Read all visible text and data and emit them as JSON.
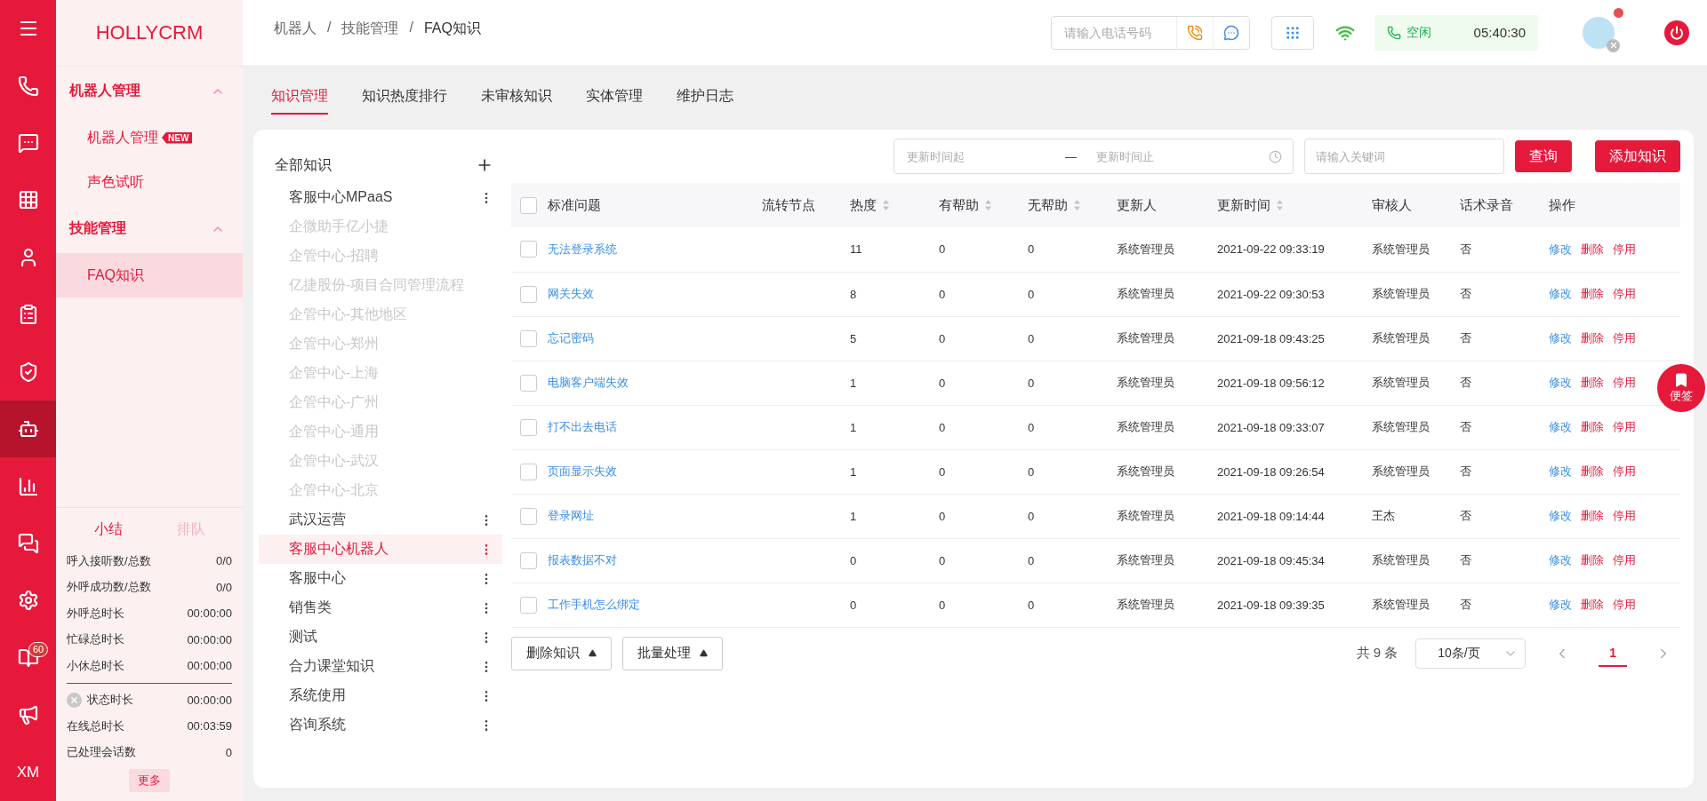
{
  "rail": {
    "items": [
      {
        "kind": "menu",
        "selected": false
      },
      {
        "kind": "phone",
        "selected": false
      },
      {
        "kind": "chat",
        "selected": false
      },
      {
        "kind": "grid",
        "selected": false
      },
      {
        "kind": "person",
        "selected": false
      },
      {
        "kind": "clipboard",
        "selected": false
      },
      {
        "kind": "shield",
        "selected": false
      },
      {
        "kind": "robot",
        "selected": true
      },
      {
        "kind": "chart",
        "selected": false
      },
      {
        "kind": "messages",
        "selected": false
      },
      {
        "kind": "gear",
        "selected": false
      },
      {
        "kind": "book",
        "selected": false,
        "badge": "60"
      },
      {
        "kind": "megaphone",
        "selected": false
      },
      {
        "kind": "text",
        "selected": false,
        "label": "XM"
      }
    ]
  },
  "sidebar": {
    "logo": "HOLLYCRM",
    "groups": [
      {
        "title": "机器人管理",
        "expanded": true,
        "items": [
          {
            "label": "机器人管理",
            "selected": false,
            "badge": "NEW"
          },
          {
            "label": "声色试听",
            "selected": false
          }
        ]
      },
      {
        "title": "技能管理",
        "expanded": true,
        "items": [
          {
            "label": "FAQ知识",
            "selected": true
          }
        ]
      }
    ],
    "stats": {
      "tabs": [
        {
          "label": "小结",
          "selected": true
        },
        {
          "label": "排队",
          "selected": false
        }
      ],
      "rows": [
        {
          "label": "呼入接听数/总数",
          "value": "0/0"
        },
        {
          "label": "外呼成功数/总数",
          "value": "0/0"
        },
        {
          "label": "外呼总时长",
          "value": "00:00:00"
        },
        {
          "label": "忙碌总时长",
          "value": "00:00:00"
        },
        {
          "label": "小休总时长",
          "value": "00:00:00"
        }
      ],
      "rows_after": [
        {
          "label": "状态时长",
          "value": "00:00:00",
          "kind": "status"
        },
        {
          "label": "在线总时长",
          "value": "00:03:59",
          "kind": "plain"
        },
        {
          "label": "已处理会话数",
          "value": "0",
          "kind": "plain"
        }
      ],
      "more": "更多"
    }
  },
  "topbar": {
    "breadcrumb": [
      "机器人",
      "技能管理",
      "FAQ知识"
    ],
    "separator": "/",
    "phone": {
      "placeholder": "请输入电话号码"
    },
    "status": {
      "label": "空闲",
      "time": "05:40:30"
    },
    "avatar": {
      "notification": true
    }
  },
  "tabs": [
    {
      "label": "知识管理",
      "selected": true
    },
    {
      "label": "知识热度排行",
      "selected": false
    },
    {
      "label": "未审核知识",
      "selected": false
    },
    {
      "label": "实体管理",
      "selected": false
    },
    {
      "label": "维护日志",
      "selected": false
    }
  ],
  "tree": {
    "title": "全部知识",
    "items": [
      {
        "label": "客服中心MPaaS",
        "disabled": false,
        "selected": false
      },
      {
        "label": "企微助手亿小捷",
        "disabled": true,
        "selected": false
      },
      {
        "label": "企管中心-招聘",
        "disabled": true,
        "selected": false
      },
      {
        "label": "亿捷股份-项目合同管理流程",
        "disabled": true,
        "selected": false
      },
      {
        "label": "企管中心-其他地区",
        "disabled": true,
        "selected": false
      },
      {
        "label": "企管中心-郑州",
        "disabled": true,
        "selected": false
      },
      {
        "label": "企管中心-上海",
        "disabled": true,
        "selected": false
      },
      {
        "label": "企管中心-广州",
        "disabled": true,
        "selected": false
      },
      {
        "label": "企管中心-通用",
        "disabled": true,
        "selected": false
      },
      {
        "label": "企管中心-武汉",
        "disabled": true,
        "selected": false
      },
      {
        "label": "企管中心-北京",
        "disabled": true,
        "selected": false
      },
      {
        "label": "武汉运营",
        "disabled": false,
        "selected": false
      },
      {
        "label": "客服中心机器人",
        "disabled": false,
        "selected": true
      },
      {
        "label": "客服中心",
        "disabled": false,
        "selected": false
      },
      {
        "label": "销售类",
        "disabled": false,
        "selected": false
      },
      {
        "label": "测试",
        "disabled": false,
        "selected": false
      },
      {
        "label": "合力课堂知识",
        "disabled": false,
        "selected": false
      },
      {
        "label": "系统使用",
        "disabled": false,
        "selected": false
      },
      {
        "label": "咨询系统",
        "disabled": false,
        "selected": false
      }
    ]
  },
  "filters": {
    "start": {
      "placeholder": "更新时间起"
    },
    "dash": "—",
    "end": {
      "placeholder": "更新时间止"
    },
    "keyword": {
      "placeholder": "请输入关键词"
    },
    "buttons": [
      "查询",
      "添加知识"
    ]
  },
  "table": {
    "columns": [
      {
        "label": "标准问题",
        "sortable": false
      },
      {
        "label": "流转节点",
        "sortable": false
      },
      {
        "label": "热度",
        "sortable": true
      },
      {
        "label": "有帮助",
        "sortable": true
      },
      {
        "label": "无帮助",
        "sortable": true
      },
      {
        "label": "更新人",
        "sortable": false
      },
      {
        "label": "更新时间",
        "sortable": true
      },
      {
        "label": "审核人",
        "sortable": false
      },
      {
        "label": "话术录音",
        "sortable": false
      },
      {
        "label": "操作",
        "sortable": false
      }
    ],
    "all_checked": false,
    "rows": [
      {
        "checked": false,
        "cells": [
          "无法登录系统",
          "",
          "11",
          "0",
          "0",
          "系统管理员",
          "2021-09-22 09:33:19",
          "系统管理员",
          "否"
        ],
        "actions": [
          {
            "label": "修改",
            "kind": "edit"
          },
          {
            "label": "删除",
            "kind": "danger"
          },
          {
            "label": "停用",
            "kind": "danger"
          }
        ]
      },
      {
        "checked": false,
        "cells": [
          "网关失效",
          "",
          "8",
          "0",
          "0",
          "系统管理员",
          "2021-09-22 09:30:53",
          "系统管理员",
          "否"
        ],
        "actions": [
          {
            "label": "修改",
            "kind": "edit"
          },
          {
            "label": "删除",
            "kind": "danger"
          },
          {
            "label": "停用",
            "kind": "danger"
          }
        ]
      },
      {
        "checked": false,
        "cells": [
          "忘记密码",
          "",
          "5",
          "0",
          "0",
          "系统管理员",
          "2021-09-18 09:43:25",
          "系统管理员",
          "否"
        ],
        "actions": [
          {
            "label": "修改",
            "kind": "edit"
          },
          {
            "label": "删除",
            "kind": "danger"
          },
          {
            "label": "停用",
            "kind": "danger"
          }
        ]
      },
      {
        "checked": false,
        "cells": [
          "电脑客户端失效",
          "",
          "1",
          "0",
          "0",
          "系统管理员",
          "2021-09-18 09:56:12",
          "系统管理员",
          "否"
        ],
        "actions": [
          {
            "label": "修改",
            "kind": "edit"
          },
          {
            "label": "删除",
            "kind": "danger"
          },
          {
            "label": "停用",
            "kind": "danger"
          }
        ]
      },
      {
        "checked": false,
        "cells": [
          "打不出去电话",
          "",
          "1",
          "0",
          "0",
          "系统管理员",
          "2021-09-18 09:33:07",
          "系统管理员",
          "否"
        ],
        "actions": [
          {
            "label": "修改",
            "kind": "edit"
          },
          {
            "label": "删除",
            "kind": "danger"
          },
          {
            "label": "停用",
            "kind": "danger"
          }
        ]
      },
      {
        "checked": false,
        "cells": [
          "页面显示失效",
          "",
          "1",
          "0",
          "0",
          "系统管理员",
          "2021-09-18 09:26:54",
          "系统管理员",
          "否"
        ],
        "actions": [
          {
            "label": "修改",
            "kind": "edit"
          },
          {
            "label": "删除",
            "kind": "danger"
          },
          {
            "label": "停用",
            "kind": "danger"
          }
        ]
      },
      {
        "checked": false,
        "cells": [
          "登录网址",
          "",
          "1",
          "0",
          "0",
          "系统管理员",
          "2021-09-18 09:14:44",
          "王杰",
          "否"
        ],
        "actions": [
          {
            "label": "修改",
            "kind": "edit"
          },
          {
            "label": "删除",
            "kind": "danger"
          },
          {
            "label": "停用",
            "kind": "danger"
          }
        ]
      },
      {
        "checked": false,
        "cells": [
          "报表数据不对",
          "",
          "0",
          "0",
          "0",
          "系统管理员",
          "2021-09-18 09:45:34",
          "系统管理员",
          "否"
        ],
        "actions": [
          {
            "label": "修改",
            "kind": "edit"
          },
          {
            "label": "删除",
            "kind": "danger"
          },
          {
            "label": "停用",
            "kind": "danger"
          }
        ]
      },
      {
        "checked": false,
        "cells": [
          "工作手机怎么绑定",
          "",
          "0",
          "0",
          "0",
          "系统管理员",
          "2021-09-18 09:39:35",
          "系统管理员",
          "否"
        ],
        "actions": [
          {
            "label": "修改",
            "kind": "edit"
          },
          {
            "label": "删除",
            "kind": "danger"
          },
          {
            "label": "停用",
            "kind": "danger"
          }
        ]
      }
    ]
  },
  "footer": {
    "buttons": [
      "删除知识",
      "批量处理"
    ],
    "total": "共 9 条",
    "page_size": "10条/页",
    "pages": [
      {
        "label": "1",
        "selected": true
      }
    ]
  },
  "float_button": {
    "label": "便签"
  }
}
